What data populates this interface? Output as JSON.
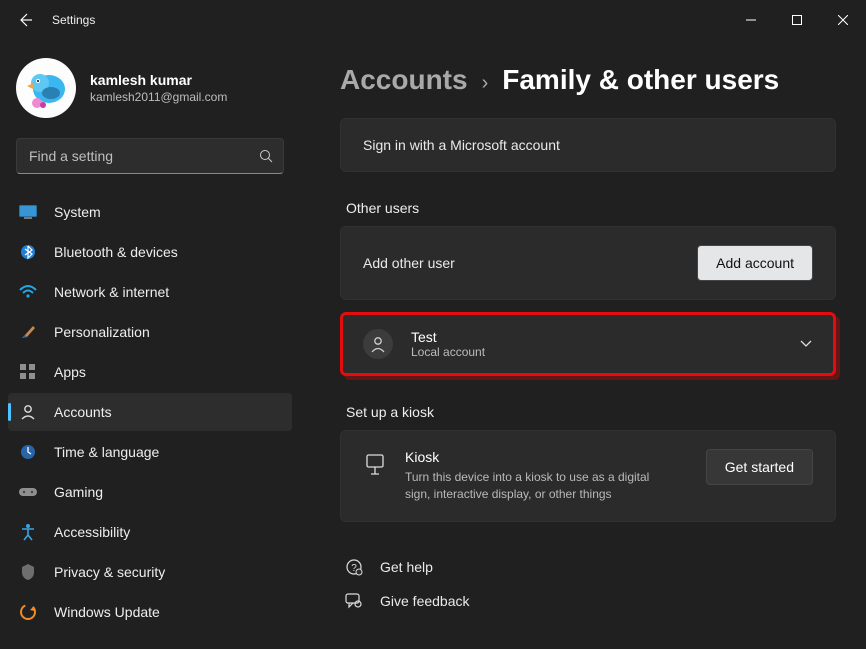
{
  "window": {
    "title": "Settings"
  },
  "user": {
    "name": "kamlesh kumar",
    "email": "kamlesh2011@gmail.com"
  },
  "search": {
    "placeholder": "Find a setting"
  },
  "nav": {
    "items": [
      {
        "label": "System"
      },
      {
        "label": "Bluetooth & devices"
      },
      {
        "label": "Network & internet"
      },
      {
        "label": "Personalization"
      },
      {
        "label": "Apps"
      },
      {
        "label": "Accounts"
      },
      {
        "label": "Time & language"
      },
      {
        "label": "Gaming"
      },
      {
        "label": "Accessibility"
      },
      {
        "label": "Privacy & security"
      },
      {
        "label": "Windows Update"
      }
    ],
    "active_index": 5
  },
  "breadcrumb": {
    "parent": "Accounts",
    "current": "Family & other users"
  },
  "signin_card": {
    "text": "Sign in with a Microsoft account"
  },
  "other_users": {
    "heading": "Other users",
    "add_label": "Add other user",
    "add_button": "Add account",
    "entries": [
      {
        "name": "Test",
        "subtitle": "Local account"
      }
    ]
  },
  "kiosk": {
    "heading": "Set up a kiosk",
    "title": "Kiosk",
    "desc": "Turn this device into a kiosk to use as a digital sign, interactive display, or other things",
    "button": "Get started"
  },
  "footer": {
    "help": "Get help",
    "feedback": "Give feedback"
  },
  "colors": {
    "accent": "#4cc2ff",
    "highlight": "#e40d0d"
  }
}
